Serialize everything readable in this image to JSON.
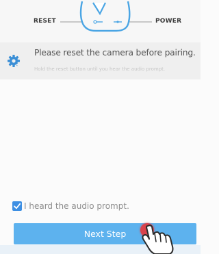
{
  "diagram": {
    "left_label": "RESET",
    "right_label": "POWER",
    "icon": "camera-reset-power-diagram"
  },
  "tip": {
    "icon": "gear-icon",
    "title": "Please reset the camera before pairing.",
    "subtitle": "Hold the reset button until you hear the audio prompt."
  },
  "confirm": {
    "checked": true,
    "label": "I heard the audio prompt."
  },
  "next_button": {
    "label": "Next Step"
  },
  "colors": {
    "accent": "#3d8fe3",
    "button": "#5db2ee",
    "tap": "#d9434c"
  }
}
